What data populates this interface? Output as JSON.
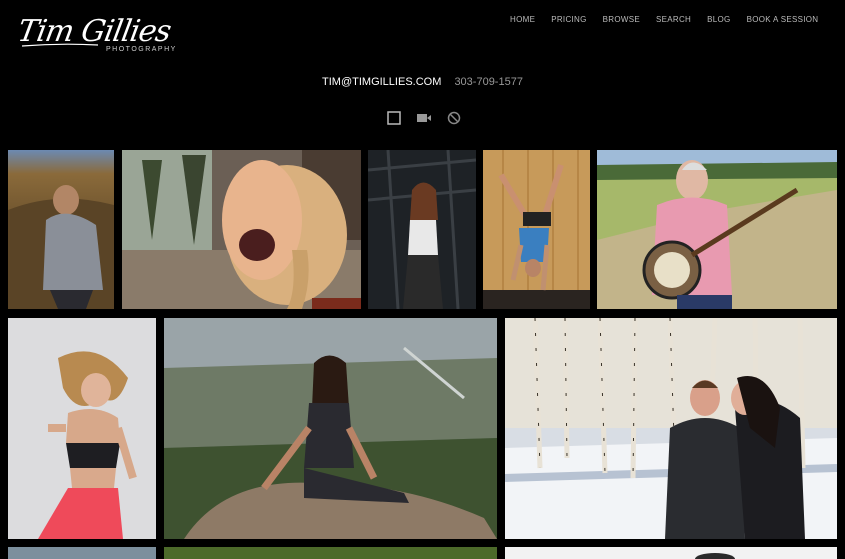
{
  "brand": {
    "name": "Tim Gillies",
    "tagline": "PHOTOGRAPHY"
  },
  "nav": [
    "HOME",
    "PRICING",
    "BROWSE",
    "SEARCH",
    "BLOG",
    "BOOK A SESSION"
  ],
  "contact": {
    "email": "TIM@TIMGILLIES.COM",
    "phone": "303-709-1577"
  },
  "toolbar": {
    "icons": [
      "square-icon",
      "video-camera-icon",
      "no-entry-icon"
    ]
  },
  "gallery": {
    "photos": [
      {
        "subject": "boy-in-field"
      },
      {
        "subject": "woman-laughing"
      },
      {
        "subject": "woman-in-gym"
      },
      {
        "subject": "handstand-against-wall"
      },
      {
        "subject": "woman-with-banjo"
      },
      {
        "subject": "woman-dancing"
      },
      {
        "subject": "woman-sitting-on-rock"
      },
      {
        "subject": "couple-kissing-in-snow"
      }
    ]
  }
}
